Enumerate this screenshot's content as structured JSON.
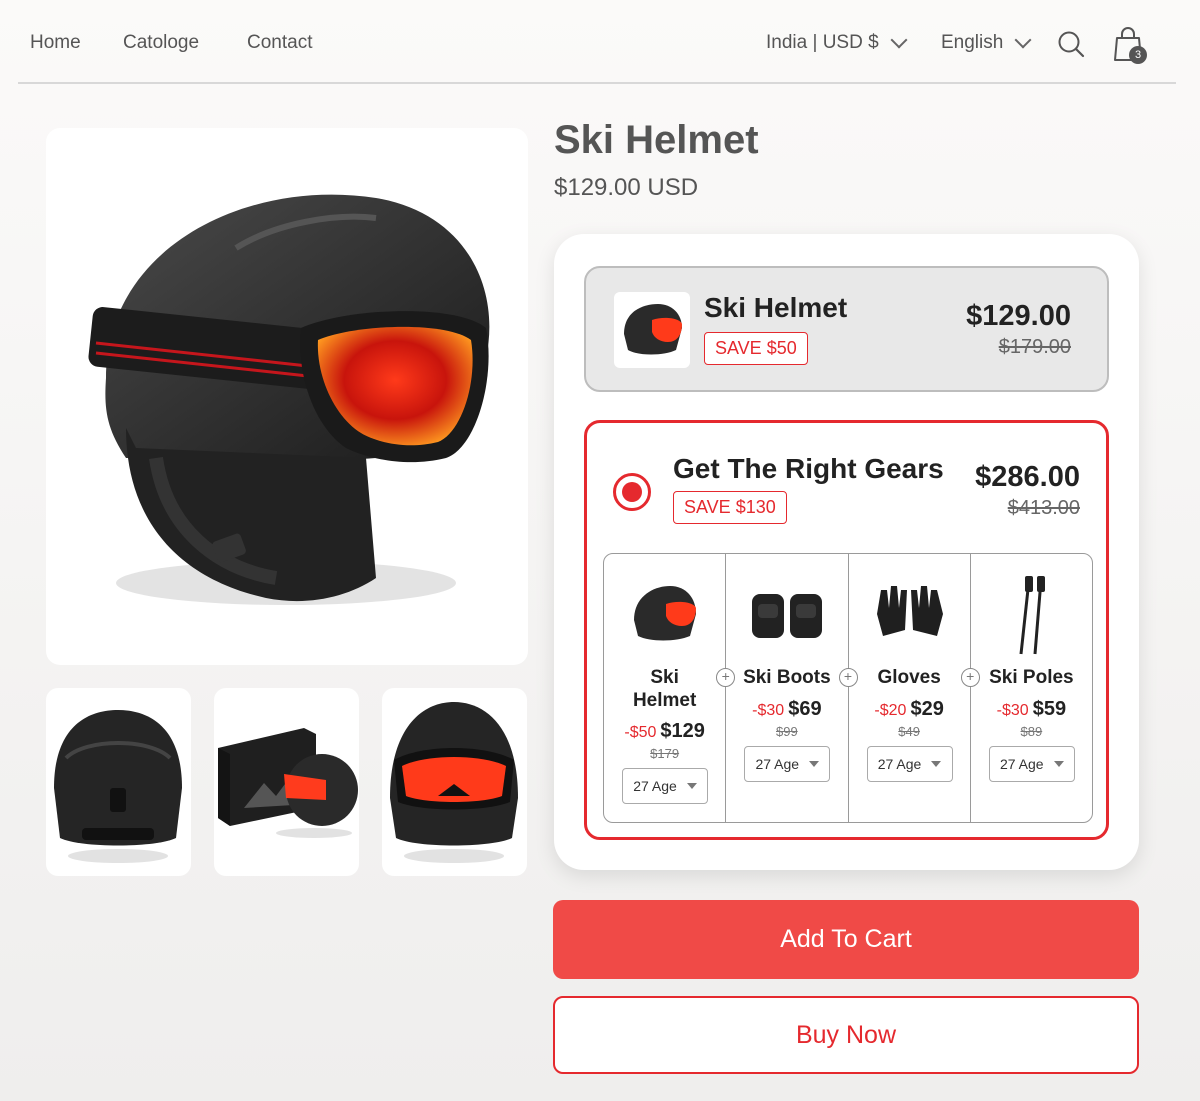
{
  "nav": {
    "links": [
      "Home",
      "Catologe",
      "Contact"
    ],
    "region": "India | USD $",
    "language": "English",
    "cart_count": "3"
  },
  "product": {
    "title": "Ski Helmet",
    "price": "$129.00 USD"
  },
  "single_offer": {
    "name": "Ski Helmet",
    "save": "SAVE $50",
    "price": "$129.00",
    "compare_price": "$179.00"
  },
  "bundle_offer": {
    "name": "Get The Right Gears",
    "save": "SAVE $130",
    "price": "$286.00",
    "compare_price": "$413.00",
    "selected": true,
    "items": [
      {
        "name_line1": "Ski",
        "name_line2": "Helmet",
        "discount": "-$50",
        "price": "$129",
        "old": "$179",
        "size": "27 Age",
        "icon": "helmet-icon"
      },
      {
        "name_line1": "Ski Boots",
        "name_line2": "",
        "discount": "-$30",
        "price": "$69",
        "old": "$99",
        "size": "27 Age",
        "icon": "boots-icon"
      },
      {
        "name_line1": "Gloves",
        "name_line2": "",
        "discount": "-$20",
        "price": "$29",
        "old": "$49",
        "size": "27 Age",
        "icon": "gloves-icon"
      },
      {
        "name_line1": "Ski Poles",
        "name_line2": "",
        "discount": "-$30",
        "price": "$59",
        "old": "$89",
        "size": "27 Age",
        "icon": "poles-icon"
      }
    ]
  },
  "actions": {
    "add_to_cart": "Add To Cart",
    "buy_now": "Buy Now"
  },
  "colors": {
    "accent": "#e5292e",
    "cart_button": "#f04a47"
  }
}
